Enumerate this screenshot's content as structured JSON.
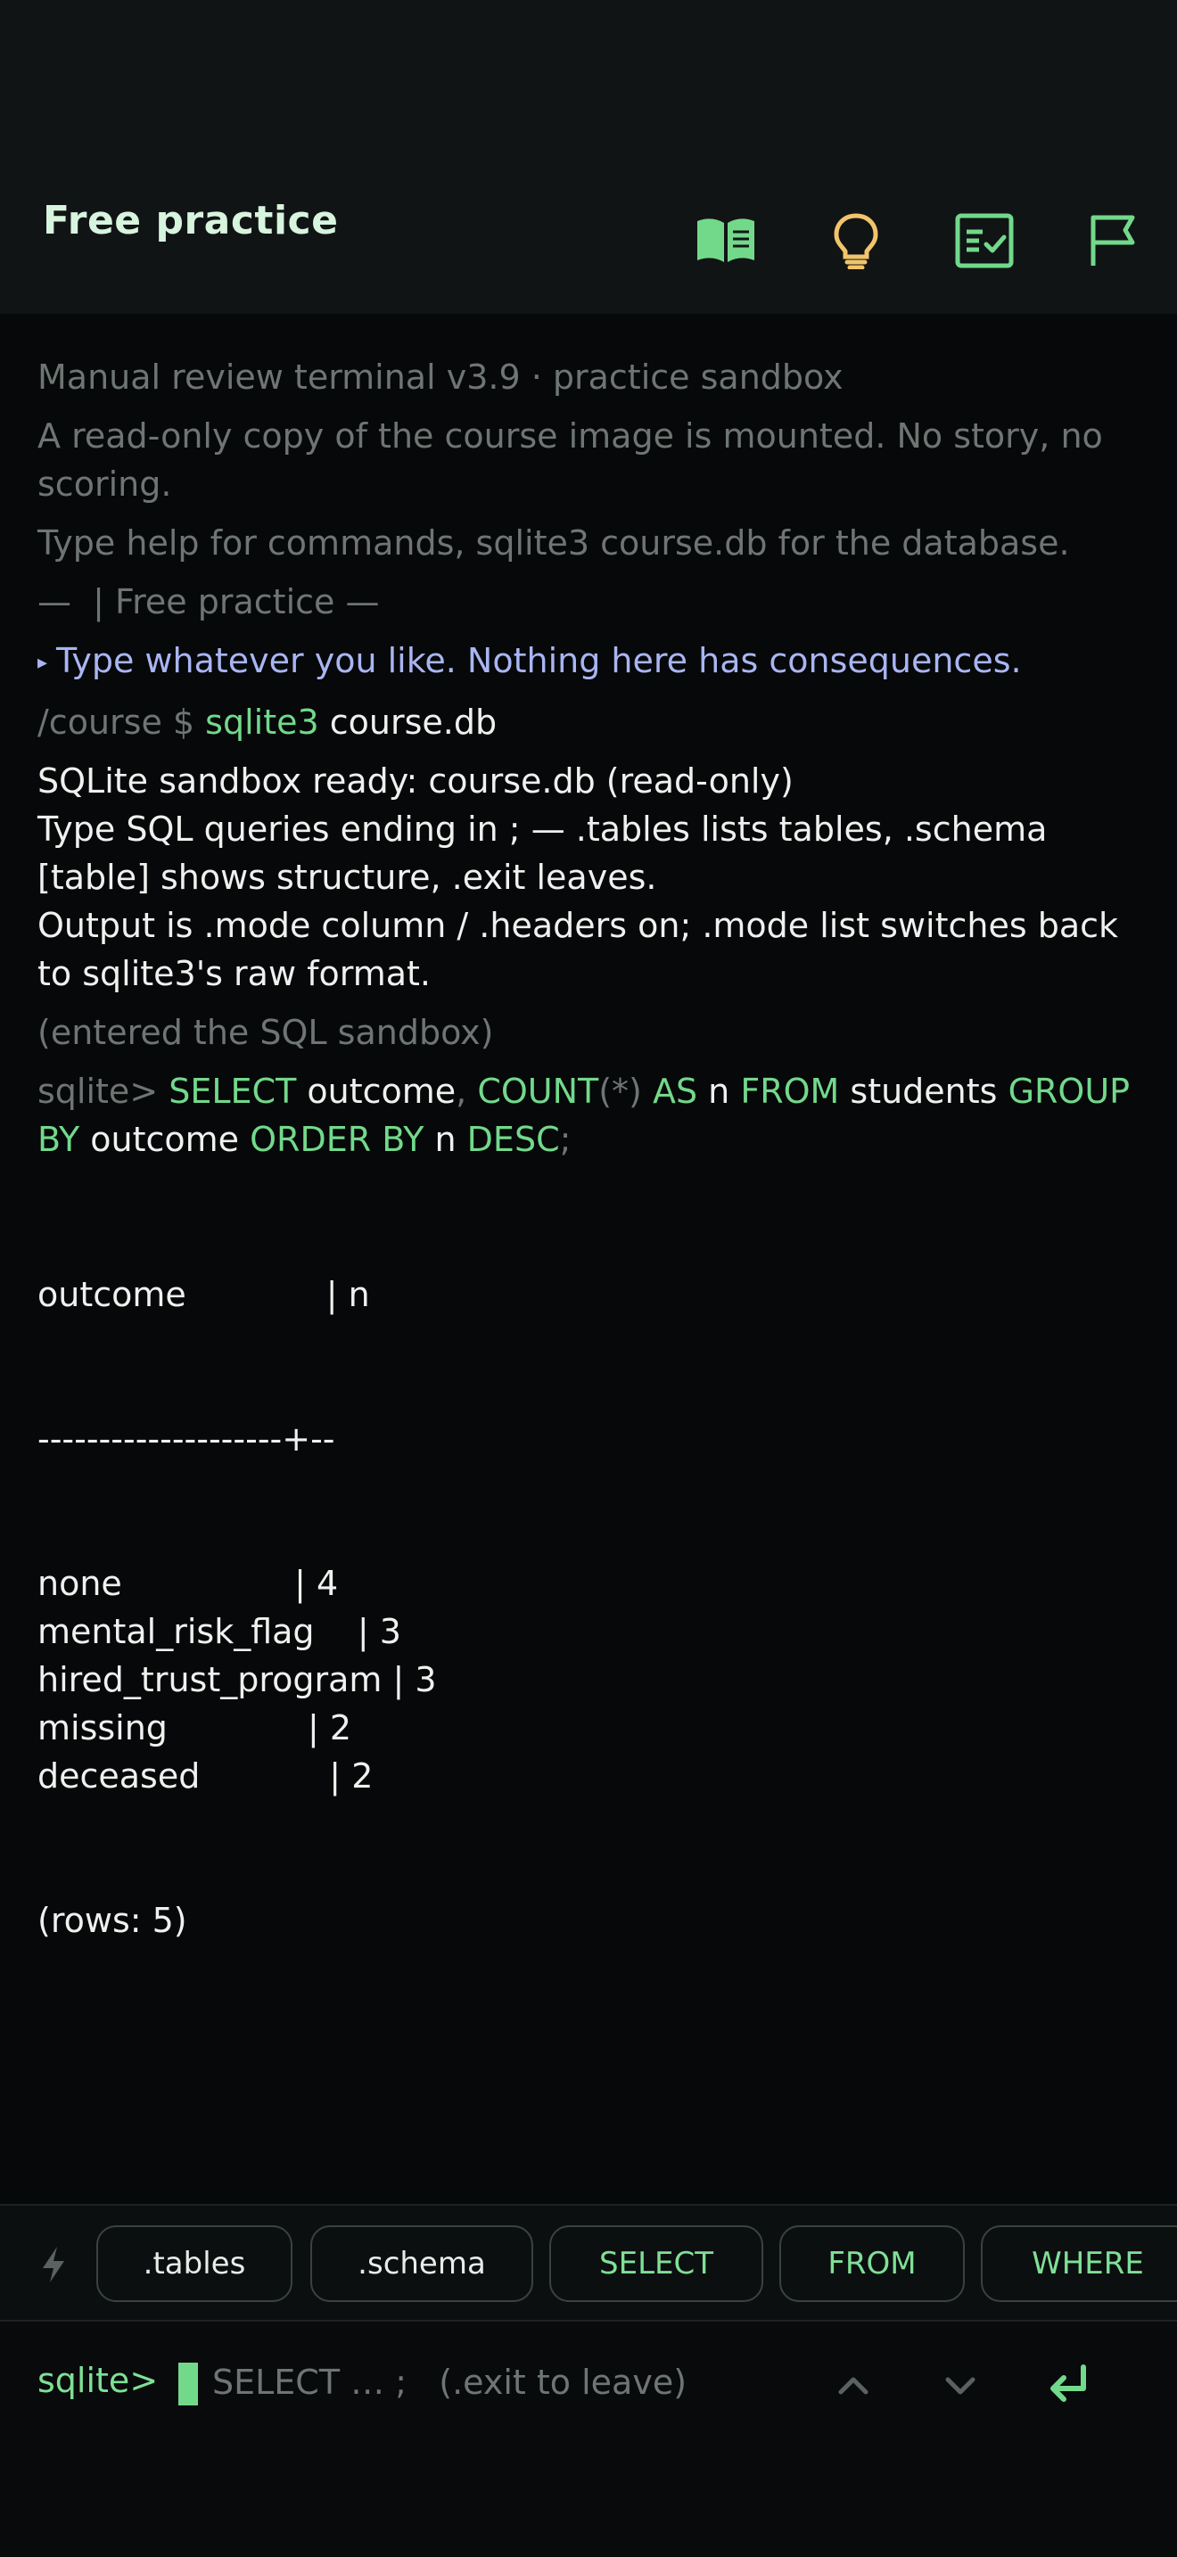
{
  "header": {
    "title": "Free practice",
    "icons": [
      "book-icon",
      "lightbulb-icon",
      "checklist-icon",
      "flag-icon"
    ]
  },
  "terminal": {
    "intro1": "Manual review terminal v3.9 · practice sandbox",
    "intro2": "A read-only copy of the course image is mounted. No story, no scoring.",
    "intro3": "Type help for commands, sqlite3 course.db for the database.",
    "divider": "—  | Free practice —",
    "hint": "Type whatever you like. Nothing here has consequences.",
    "shell_prompt": "/course $ ",
    "shell_cmd": "sqlite3",
    "shell_arg": " course.db",
    "ready1": "SQLite sandbox ready: course.db (read-only)",
    "ready2": "Type SQL queries ending in ; — .tables lists tables, .schema [table] shows structure, .exit leaves.",
    "ready3": "Output is .mode column / .headers on; .mode list switches back to sqlite3's raw format.",
    "entered": "(entered the SQL sandbox)",
    "sql_prompt": "sqlite> ",
    "query": {
      "select": "SELECT",
      "col": " outcome",
      "comma": ", ",
      "count": "COUNT",
      "star": "(*)",
      "as": " AS",
      "n1": " n ",
      "from": "FROM",
      "table": " students",
      "groupby": "GROUP BY",
      "col2": " outcome ",
      "orderby": "ORDER BY",
      "n2": " n ",
      "desc": "DESC",
      "semi": ";"
    },
    "result_header": "outcome             | n",
    "result_sep": "--------------------+--",
    "rows": [
      {
        "outcome": "none",
        "n": "4"
      },
      {
        "outcome": "mental_risk_flag",
        "n": "3"
      },
      {
        "outcome": "hired_trust_program",
        "n": "3"
      },
      {
        "outcome": "missing",
        "n": "2"
      },
      {
        "outcome": "deceased",
        "n": "2"
      }
    ],
    "row_count": "(rows: 5)"
  },
  "chips": [
    ".tables",
    ".schema",
    "SELECT",
    "FROM",
    "WHERE"
  ],
  "input": {
    "prompt": "sqlite>",
    "placeholder": "SELECT … ;   (.exit to leave)"
  },
  "colors": {
    "accent_green": "#72d98b",
    "hint_blue": "#a9b5f2",
    "lightbulb_yellow": "#f2c46b",
    "background": "#060809"
  }
}
